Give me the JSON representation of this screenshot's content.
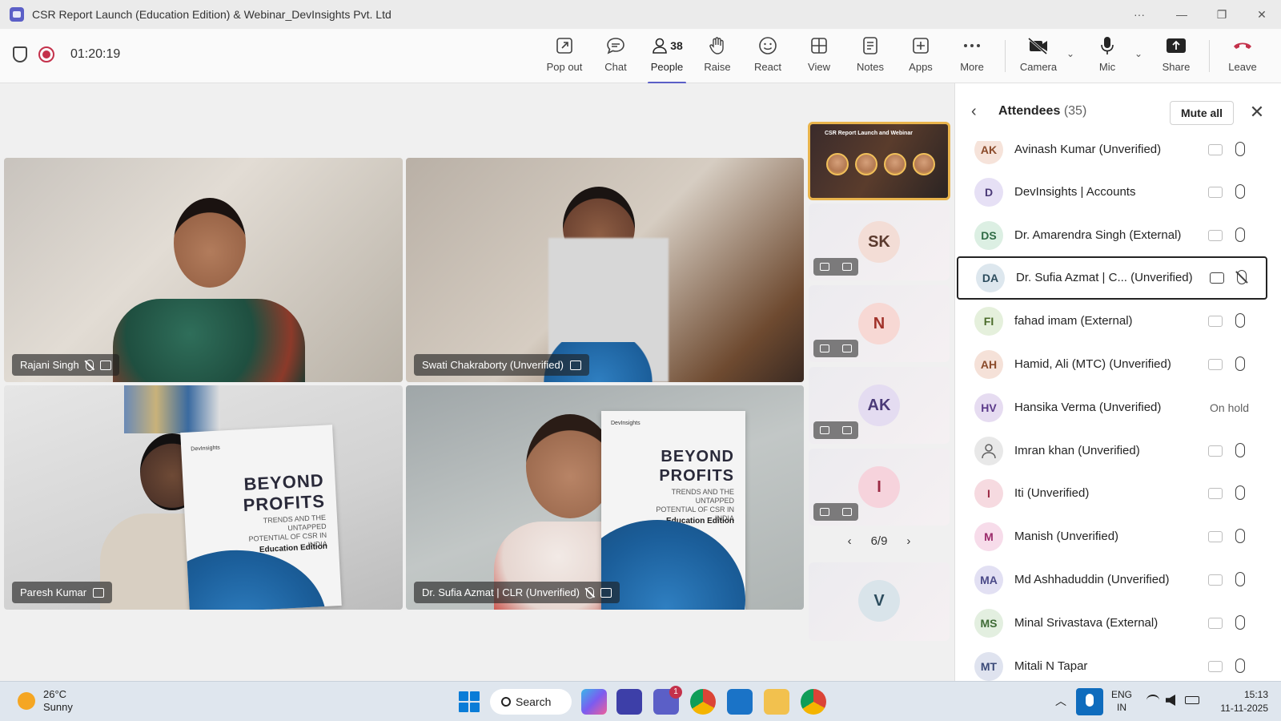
{
  "window": {
    "title": "CSR Report Launch (Education Edition) & Webinar_DevInsights Pvt. Ltd",
    "more_label": "···",
    "minimize_label": "—",
    "maximize_label": "❐",
    "close_label": "✕"
  },
  "meeting": {
    "timer": "01:20:19"
  },
  "toolbar": {
    "popout_label": "Pop out",
    "chat_label": "Chat",
    "people_label": "People",
    "people_count": "38",
    "raise_label": "Raise",
    "react_label": "React",
    "view_label": "View",
    "notes_label": "Notes",
    "apps_label": "Apps",
    "more_label": "More",
    "camera_label": "Camera",
    "mic_label": "Mic",
    "share_label": "Share",
    "leave_label": "Leave"
  },
  "stage": {
    "tiles": [
      {
        "name": "Rajani Singh"
      },
      {
        "name": "Swati Chakraborty (Unverified)"
      },
      {
        "name": "Paresh Kumar"
      },
      {
        "name": "Dr. Sufia Azmat | CLR (Unverified)"
      }
    ],
    "book": {
      "title_line1": "BEYOND",
      "title_line2": "PROFITS",
      "subtitle": "TRENDS AND THE UNTAPPED POTENTIAL OF CSR IN INDIA",
      "edition": "Education Edition",
      "publisher": "DevInsights"
    },
    "featured_banner": "CSR Report Launch and Webinar",
    "strip": [
      {
        "initials": "SK",
        "bg": "#f3ddd6",
        "fg": "#5b3a2e"
      },
      {
        "initials": "N",
        "bg": "#f7d8d4",
        "fg": "#a1322a"
      },
      {
        "initials": "AK",
        "bg": "#e4dcf1",
        "fg": "#4b3a78"
      },
      {
        "initials": "I",
        "bg": "#f6d3dc",
        "fg": "#9b2a44"
      },
      {
        "initials": "V",
        "bg": "#d9e4ea",
        "fg": "#2d4d5e"
      }
    ],
    "pager": {
      "text": "6/9",
      "prev": "‹",
      "next": "›"
    }
  },
  "attendees": {
    "title": "Attendees",
    "count": "(35)",
    "mute_all_label": "Mute all",
    "list": [
      {
        "initials": "AK",
        "name": "Avinash Kumar (Unverified)",
        "bg": "#f6e3da",
        "fg": "#8a4a2a",
        "status": ""
      },
      {
        "initials": "D",
        "name": "DevInsights | Accounts",
        "bg": "#e6e0f5",
        "fg": "#4b3a78",
        "status": ""
      },
      {
        "initials": "DS",
        "name": "Dr. Amarendra Singh (External)",
        "bg": "#dcefe3",
        "fg": "#2f6b45",
        "status": ""
      },
      {
        "initials": "DA",
        "name": "Dr. Sufia Azmat | C... (Unverified)",
        "bg": "#dde7ee",
        "fg": "#2d4d5e",
        "status": ""
      },
      {
        "initials": "FI",
        "name": "fahad imam (External)",
        "bg": "#e5f0dc",
        "fg": "#4a6b2a",
        "status": ""
      },
      {
        "initials": "AH",
        "name": "Hamid, Ali (MTC) (Unverified)",
        "bg": "#f5e1d8",
        "fg": "#8a4a2a",
        "status": ""
      },
      {
        "initials": "HV",
        "name": "Hansika Verma (Unverified)",
        "bg": "#e6dcf1",
        "fg": "#5b3a8a",
        "status": "On hold"
      },
      {
        "initials": "",
        "name": "Imran khan (Unverified)",
        "bg": "#e8e8e8",
        "fg": "#616161",
        "status": ""
      },
      {
        "initials": "I",
        "name": "Iti (Unverified)",
        "bg": "#f6dae0",
        "fg": "#9b2a44",
        "status": ""
      },
      {
        "initials": "M",
        "name": "Manish (Unverified)",
        "bg": "#f7dcea",
        "fg": "#9b2a6a",
        "status": ""
      },
      {
        "initials": "MA",
        "name": "Md Ashhaduddin (Unverified)",
        "bg": "#e2e0f3",
        "fg": "#4b4a88",
        "status": ""
      },
      {
        "initials": "MS",
        "name": "Minal Srivastava (External)",
        "bg": "#e3efe0",
        "fg": "#3f6b36",
        "status": ""
      },
      {
        "initials": "MT",
        "name": "Mitali N Tapar",
        "bg": "#dfe3ef",
        "fg": "#3a4a78",
        "status": ""
      }
    ]
  },
  "taskbar": {
    "temperature": "26°C",
    "condition": "Sunny",
    "search_label": "Search",
    "teams_badge": "1",
    "lang": "ENG",
    "region": "IN",
    "time": "15:13",
    "date": "11-11-2025"
  }
}
